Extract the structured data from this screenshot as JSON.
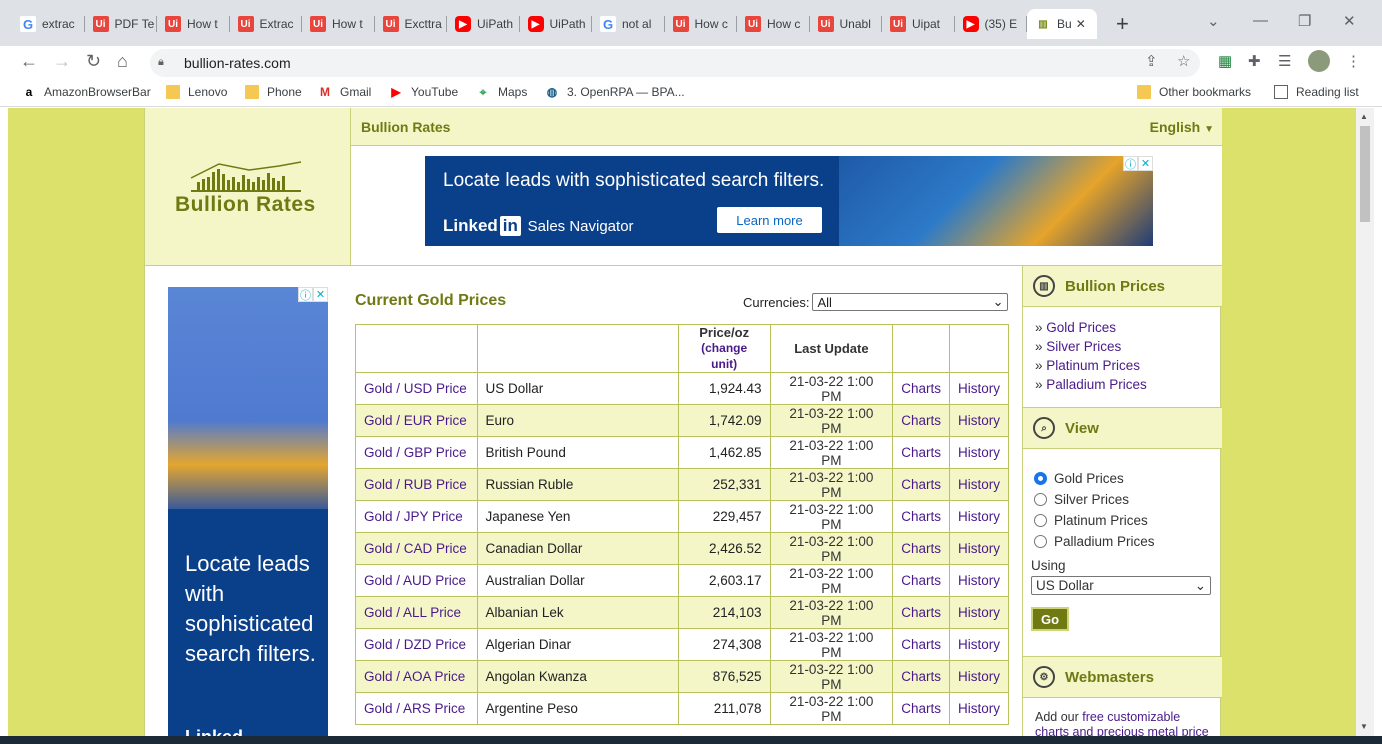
{
  "browser": {
    "tabs": [
      {
        "label": "extrac",
        "icon": "google-icon"
      },
      {
        "label": "PDF Te",
        "icon": "uipath-icon"
      },
      {
        "label": "How t",
        "icon": "uipath-icon"
      },
      {
        "label": "Extrac",
        "icon": "uipath-icon"
      },
      {
        "label": "How t",
        "icon": "uipath-icon"
      },
      {
        "label": "Excttra",
        "icon": "uipath-icon"
      },
      {
        "label": "UiPath",
        "icon": "youtube-icon"
      },
      {
        "label": "UiPath",
        "icon": "youtube-icon"
      },
      {
        "label": "not al",
        "icon": "google-icon"
      },
      {
        "label": "How c",
        "icon": "uipath-icon"
      },
      {
        "label": "How c",
        "icon": "uipath-icon"
      },
      {
        "label": "Unabl",
        "icon": "uipath-icon"
      },
      {
        "label": "Uipat",
        "icon": "uipath-icon"
      },
      {
        "label": "(35) E",
        "icon": "youtube-icon"
      },
      {
        "label": "Bu",
        "icon": "bullion-icon"
      }
    ],
    "url": "bullion-rates.com",
    "bookmarks": [
      {
        "label": "AmazonBrowserBar",
        "icon": "amazon-icon"
      },
      {
        "label": "Lenovo",
        "icon": "folder-icon"
      },
      {
        "label": "Phone",
        "icon": "folder-icon"
      },
      {
        "label": "Gmail",
        "icon": "gmail-icon"
      },
      {
        "label": "YouTube",
        "icon": "youtube-icon"
      },
      {
        "label": "Maps",
        "icon": "maps-icon"
      },
      {
        "label": "3. OpenRPA — BPA...",
        "icon": "openrpa-icon"
      }
    ],
    "other_bookmarks": "Other bookmarks",
    "reading_list": "Reading list"
  },
  "site": {
    "logo_text": "Bullion Rates",
    "top_title": "Bullion Rates",
    "language": "English",
    "ad_banner": {
      "headline": "Locate leads with sophisticated search filters.",
      "brand": "Linked",
      "brand_in": "in",
      "product": "Sales Navigator",
      "cta": "Learn more"
    },
    "left_ad": {
      "copy": "Locate leads with sophisticated search filters.",
      "brand": "Linked"
    }
  },
  "main": {
    "title": "Current Gold Prices",
    "currencies_label": "Currencies:",
    "currencies_value": "All",
    "table": {
      "col_price": "Price/oz",
      "col_change_unit": "(change unit)",
      "col_last_update": "Last Update",
      "rows": [
        {
          "pair": "Gold / USD Price",
          "name": "US Dollar",
          "price": "1,924.43",
          "updated": "21-03-22 1:00 PM",
          "charts": "Charts",
          "history": "History"
        },
        {
          "pair": "Gold / EUR Price",
          "name": "Euro",
          "price": "1,742.09",
          "updated": "21-03-22 1:00 PM",
          "charts": "Charts",
          "history": "History"
        },
        {
          "pair": "Gold / GBP Price",
          "name": "British Pound",
          "price": "1,462.85",
          "updated": "21-03-22 1:00 PM",
          "charts": "Charts",
          "history": "History"
        },
        {
          "pair": "Gold / RUB Price",
          "name": "Russian Ruble",
          "price": "252,331",
          "updated": "21-03-22 1:00 PM",
          "charts": "Charts",
          "history": "History"
        },
        {
          "pair": "Gold / JPY Price",
          "name": "Japanese Yen",
          "price": "229,457",
          "updated": "21-03-22 1:00 PM",
          "charts": "Charts",
          "history": "History"
        },
        {
          "pair": "Gold / CAD Price",
          "name": "Canadian Dollar",
          "price": "2,426.52",
          "updated": "21-03-22 1:00 PM",
          "charts": "Charts",
          "history": "History"
        },
        {
          "pair": "Gold / AUD Price",
          "name": "Australian Dollar",
          "price": "2,603.17",
          "updated": "21-03-22 1:00 PM",
          "charts": "Charts",
          "history": "History"
        },
        {
          "pair": "Gold / ALL Price",
          "name": "Albanian Lek",
          "price": "214,103",
          "updated": "21-03-22 1:00 PM",
          "charts": "Charts",
          "history": "History"
        },
        {
          "pair": "Gold / DZD Price",
          "name": "Algerian Dinar",
          "price": "274,308",
          "updated": "21-03-22 1:00 PM",
          "charts": "Charts",
          "history": "History"
        },
        {
          "pair": "Gold / AOA Price",
          "name": "Angolan Kwanza",
          "price": "876,525",
          "updated": "21-03-22 1:00 PM",
          "charts": "Charts",
          "history": "History"
        },
        {
          "pair": "Gold / ARS Price",
          "name": "Argentine Peso",
          "price": "211,078",
          "updated": "21-03-22 1:00 PM",
          "charts": "Charts",
          "history": "History"
        }
      ]
    }
  },
  "sidebar": {
    "bullion_prices": {
      "title": "Bullion Prices",
      "links": [
        "Gold Prices",
        "Silver Prices",
        "Platinum Prices",
        "Palladium Prices"
      ]
    },
    "view": {
      "title": "View",
      "options": [
        "Gold Prices",
        "Silver Prices",
        "Platinum Prices",
        "Palladium Prices"
      ],
      "selected": "Gold Prices",
      "using_label": "Using",
      "using_value": "US Dollar",
      "go": "Go"
    },
    "webmasters": {
      "title": "Webmasters",
      "text_prefix": "Add our ",
      "link1": "free customizable",
      "link2": "charts and precious metal price"
    }
  },
  "colors": {
    "page_bg": "#dbe16a",
    "accent": "#6f7a13",
    "link": "#4a1a8a",
    "row_alt": "#f4f6c8"
  }
}
